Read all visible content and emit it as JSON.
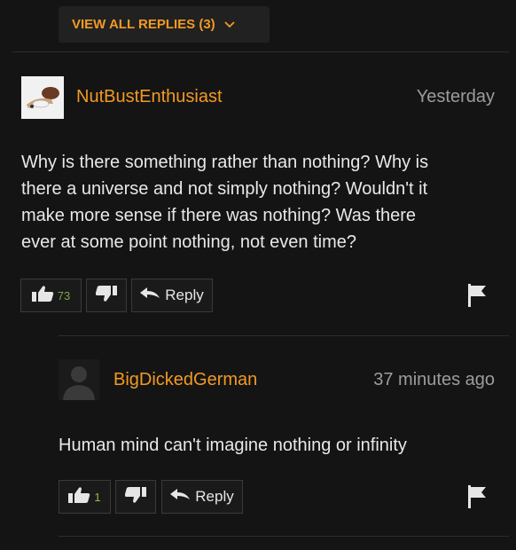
{
  "view_replies": {
    "label": "VIEW ALL REPLIES (3)"
  },
  "comments": [
    {
      "username": "NutBustEnthusiast",
      "timestamp": "Yesterday",
      "lines": [
        "Why is there something rather than nothing? Why is",
        "there a universe and not simply nothing? Wouldn't it",
        "make more sense if there was nothing? Was there",
        "ever at some point nothing, not even time?"
      ],
      "upvotes": "73",
      "reply_label": "Reply"
    },
    {
      "username": "BigDickedGerman",
      "timestamp": "37 minutes ago",
      "lines": [
        "Human mind can't imagine nothing or infinity"
      ],
      "upvotes": "1",
      "reply_label": "Reply"
    }
  ],
  "colors": {
    "accent": "#f19a24",
    "background": "#141414",
    "upvote_count_main": "#7ea34a",
    "upvote_count_reply": "#8fbf3f"
  }
}
